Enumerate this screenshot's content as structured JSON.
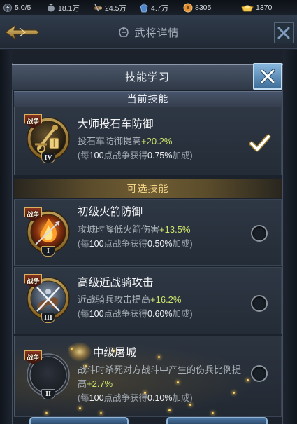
{
  "status_bar": {
    "resources": [
      {
        "icon": "stamina-icon",
        "value": "5.0/5"
      },
      {
        "icon": "food-icon",
        "value": "18.1万"
      },
      {
        "icon": "wood-icon",
        "value": "24.5万"
      },
      {
        "icon": "iron-icon",
        "value": "4.7万"
      },
      {
        "icon": "copper-coin-icon",
        "value": "8305"
      },
      {
        "icon": "gold-ingot-icon",
        "value": "1370"
      }
    ]
  },
  "page_header": {
    "title": "武将详情",
    "title_icon": "general-helmet-icon",
    "back_icon": "back-arrow-icon",
    "close_icon": "close-icon"
  },
  "dialog": {
    "title": "技能学习",
    "close_icon": "close-icon",
    "current_section": {
      "title": "当前技能",
      "skills": [
        {
          "icon": "catapult-skill-icon",
          "badge": "战争",
          "level": "IV",
          "name": "大师投石车防御",
          "desc": "投石车防御提高",
          "value": "+20.2%",
          "note": [
            "(每",
            "100",
            "点战争获得",
            "0.75%",
            "加成)"
          ],
          "selected": true,
          "state_icon": "checkmark-icon"
        }
      ]
    },
    "optional_section": {
      "title": "可选技能",
      "skills": [
        {
          "icon": "fire-arrow-skill-icon",
          "badge": "战争",
          "level": "I",
          "name": "初级火箭防御",
          "desc": "攻城时降低火箭伤害",
          "value": "+13.5%",
          "note": [
            "(每",
            "100",
            "点战争获得",
            "0.50%",
            "加成)"
          ],
          "selected": false
        },
        {
          "icon": "cavalry-skill-icon",
          "badge": "战争",
          "level": "III",
          "name": "高级近战骑攻击",
          "desc": "近战骑兵攻击提高",
          "value": "+16.2%",
          "note": [
            "(每",
            "100",
            "点战争获得",
            "0.60%",
            "加成)"
          ],
          "selected": false
        },
        {
          "icon": "massacre-skill-icon",
          "badge": "战争",
          "level": "II",
          "name": "中级屠城",
          "desc": "战斗时杀死对方战斗中产生的伤兵比例提高",
          "value": "+2.7%",
          "note": [
            "(每",
            "100",
            "点战争获得",
            "0.10%",
            "加成)"
          ],
          "selected": false
        }
      ]
    }
  },
  "colors": {
    "background": "#1a2029",
    "section_gold_text": "#f2d486",
    "bonus_value": "#cde36b",
    "body_text": "#a9b0b8",
    "close_button": "#5f90ba"
  }
}
